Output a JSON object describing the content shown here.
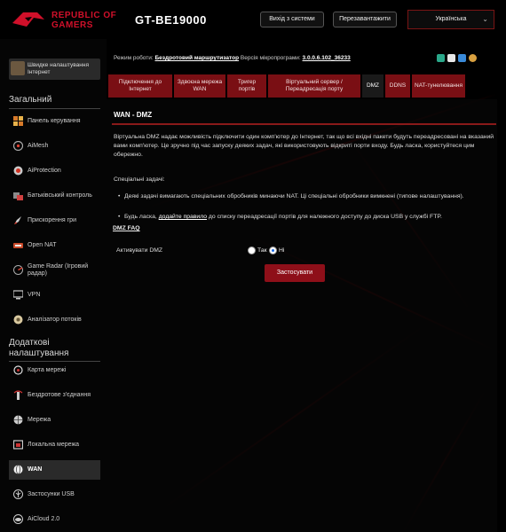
{
  "header": {
    "brand_line1": "REPUBLIC OF",
    "brand_line2": "GAMERS",
    "model": "GT-BE19000",
    "logout_label": "Вихід з системи",
    "reboot_label": "Перезавантажити",
    "language": "Українська"
  },
  "sidebar": {
    "quick_setup": "Швидке налаштування Інтернет",
    "general_title": "Загальний",
    "general_items": [
      {
        "label": "Панель керування",
        "icon": "dashboard-icon"
      },
      {
        "label": "AiMesh",
        "icon": "aimesh-icon"
      },
      {
        "label": "AiProtection",
        "icon": "shield-icon"
      },
      {
        "label": "Батьківський контроль",
        "icon": "parental-control-icon"
      },
      {
        "label": "Прискорення гри",
        "icon": "rocket-icon"
      },
      {
        "label": "Open NAT",
        "icon": "open-nat-icon"
      },
      {
        "label": "Game Radar (Ігровий радар)",
        "icon": "radar-icon"
      },
      {
        "label": "VPN",
        "icon": "vpn-icon"
      },
      {
        "label": "Аналізатор потоків",
        "icon": "traffic-analyzer-icon"
      }
    ],
    "advanced_title": "Додаткові налаштування",
    "advanced_items": [
      {
        "label": "Карта мережі",
        "icon": "network-map-icon"
      },
      {
        "label": "Бездротове з'єднання",
        "icon": "wireless-icon"
      },
      {
        "label": "Мережа",
        "icon": "globe-icon"
      },
      {
        "label": "Локальна мережа",
        "icon": "lan-icon"
      },
      {
        "label": "WAN",
        "icon": "wan-globe-icon"
      },
      {
        "label": "Застосунки USB",
        "icon": "usb-icon"
      },
      {
        "label": "AiCloud 2.0",
        "icon": "cloud-icon"
      }
    ]
  },
  "status": {
    "mode_label": "Режим роботи:",
    "mode_value": "Бездротовий маршрутизатор",
    "fw_label": "Версія мікропрограми:",
    "fw_value": "3.0.0.6.102_36233"
  },
  "tabs": [
    "Підключення до Інтернет",
    "Здвоєна мережа WAN",
    "Тригер портів",
    "Віртуальний сервер / Переадресація порту",
    "DMZ",
    "DDNS",
    "NAT-тунелювання"
  ],
  "main": {
    "title": "WAN - DMZ",
    "description": "Віртуальна DMZ надає можливість підключити один комп'ютер до Інтернет, так що всі вхідні пакети будуть переадресовані на вказаний вами комп'ютер. Це зручно під час запуску деяких задач, які використовують відкриті порти входу. Будь ласка, користуйтеся цим обережно.",
    "special_title": "Спеціальні задачі:",
    "bullet1": "Деякі задачі вимагають спеціальних обробників минаючи NAT. Ці спеціальні обробники вимкнені (типове налаштування).",
    "bullet2_pre": "Будь ласка, ",
    "bullet2_link": "додайте правило",
    "bullet2_post": " до списку переадресації портів для належного доступу до диска USB у службі FTP.",
    "faq": "DMZ  FAQ",
    "enable_label": "Активувати DMZ",
    "yes": "Так",
    "no": "Ні",
    "enabled": false,
    "apply_label": "Застосувати"
  }
}
